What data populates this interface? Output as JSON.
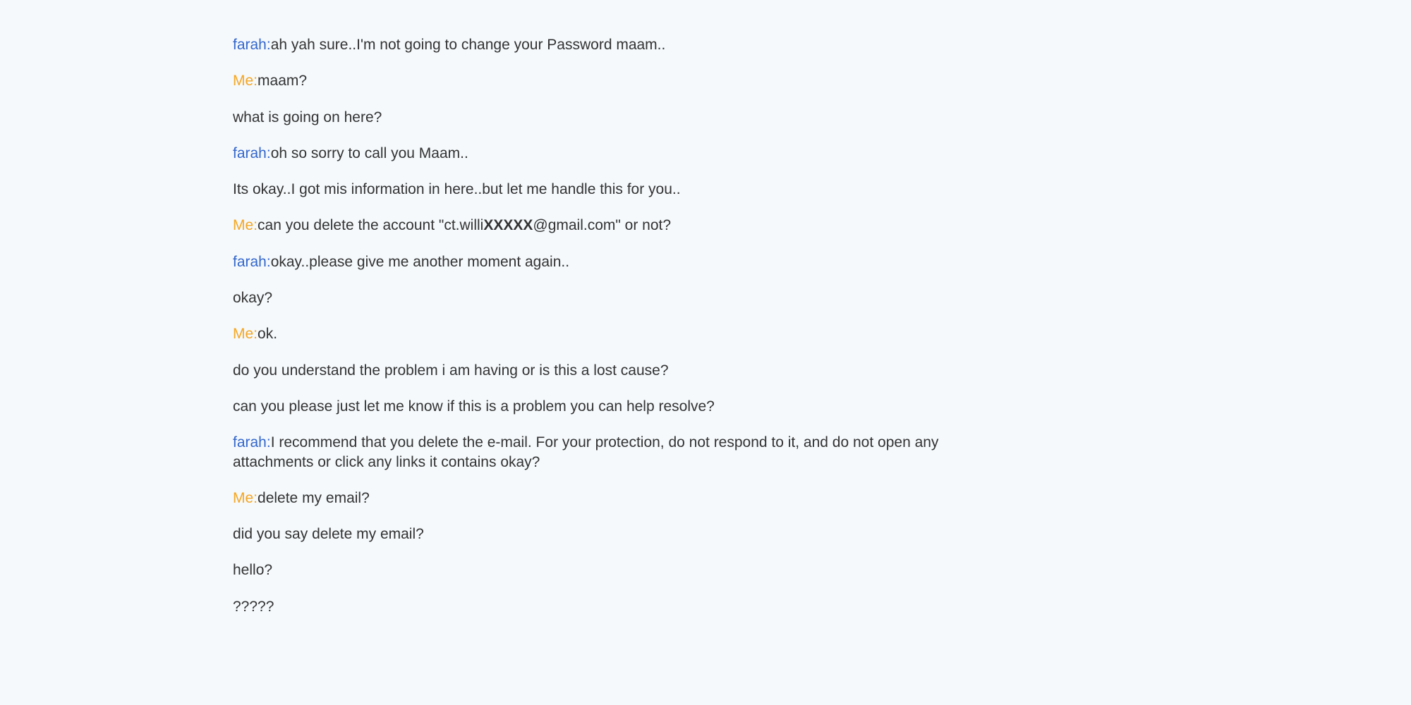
{
  "speakers": {
    "farah": "farah:",
    "me": "Me:"
  },
  "messages": {
    "m1": "ah yah sure..I'm not going to change your Password maam..",
    "m2": "maam?",
    "m3": "what is going on here?",
    "m4": "oh so sorry to call you Maam..",
    "m5": "Its okay..I got mis information in here..but let me handle this for you..",
    "m6a": "can you delete the account \"ct.willi",
    "m6b": "XXXXX",
    "m6c": "@gmail.com\" or not?",
    "m7": "okay..please give me another moment again..",
    "m8": "okay?",
    "m9": "ok.",
    "m10": "do you understand the problem i am having or is this a lost cause?",
    "m11": "can you please just let me know if this is a problem you can help resolve?",
    "m12": "I recommend that you delete the e-mail. For your protection, do not respond to it, and do not open any attachments or click any links it contains okay?",
    "m13": "delete my email?",
    "m14": "did you say delete my email?",
    "m15": "hello?",
    "m16": "?????"
  }
}
